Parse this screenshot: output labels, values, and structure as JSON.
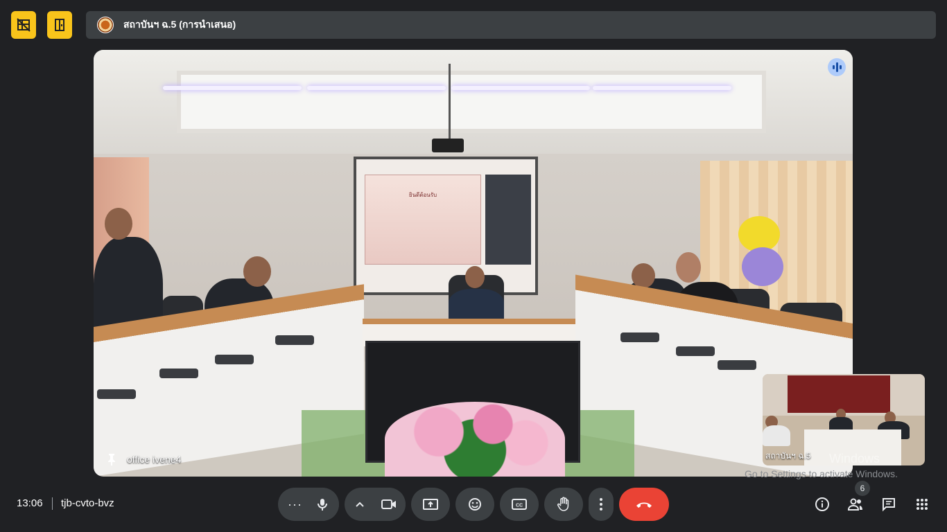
{
  "top": {
    "meeting_title": "สถาบันฯ ฉ.5 (การนำเสนอ)",
    "layout_button_icon": "grid-off-icon",
    "door_button_icon": "door-icon"
  },
  "main_tile": {
    "participant_name": "office ivene4",
    "pin_icon": "pin-icon",
    "speaking_icon": "audio-level-icon",
    "screen_text": "ยินดีต้อนรับ"
  },
  "self_view": {
    "participant_name": "สถาบันฯ ฉ.5"
  },
  "watermark": {
    "overlay": "Windows",
    "text": "Go to Settings to activate Windows."
  },
  "bottom_bar": {
    "time": "13:06",
    "meeting_code": "tjb-cvto-bvz",
    "participant_count": "6"
  },
  "colors": {
    "background": "#202124",
    "control": "#3c4043",
    "end_call": "#ea4335",
    "accent_yellow": "#f9c41b"
  }
}
